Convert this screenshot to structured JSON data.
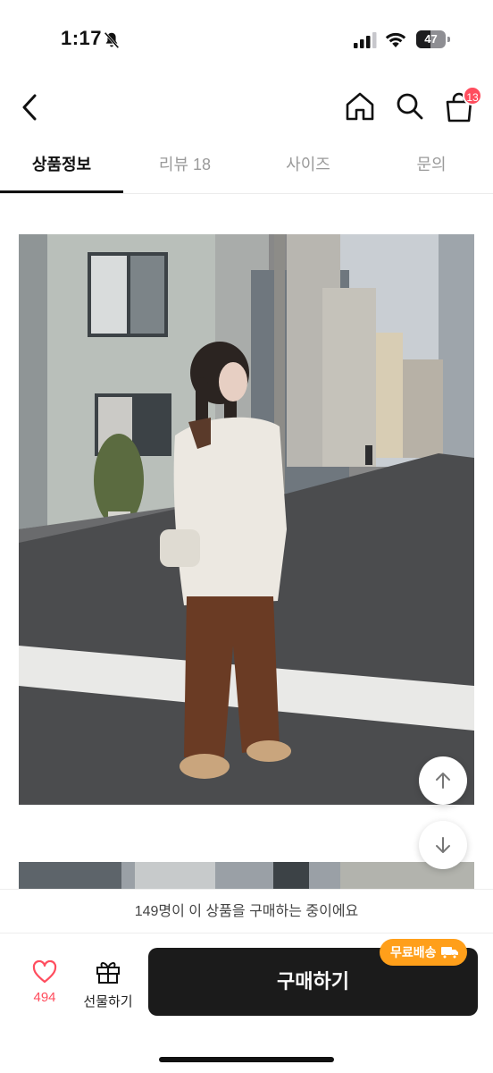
{
  "status": {
    "time": "1:17",
    "battery": "47",
    "battery_level": 0.47
  },
  "header": {
    "cart_count": "13"
  },
  "tabs": [
    {
      "label": "상품정보",
      "active": true
    },
    {
      "label": "리뷰 18",
      "active": false
    },
    {
      "label": "사이즈",
      "active": false
    },
    {
      "label": "문의",
      "active": false
    }
  ],
  "notice": "149명이 이 상품을 구매하는 중이에요",
  "bottom": {
    "like_count": "494",
    "gift_label": "선물하기",
    "buy_label": "구매하기",
    "shipping_badge": "무료배송"
  },
  "colors": {
    "accent_red": "#ff4d5e",
    "badge_orange": "#ff9f1a",
    "buy_dark": "#1b1b1b"
  },
  "icons": [
    "bell-slash-icon",
    "cellular-signal-icon",
    "wifi-icon",
    "battery-icon",
    "back-arrow-icon",
    "home-icon",
    "search-icon",
    "shopping-bag-icon",
    "heart-icon",
    "gift-icon",
    "truck-icon",
    "arrow-up-icon",
    "arrow-down-icon"
  ]
}
